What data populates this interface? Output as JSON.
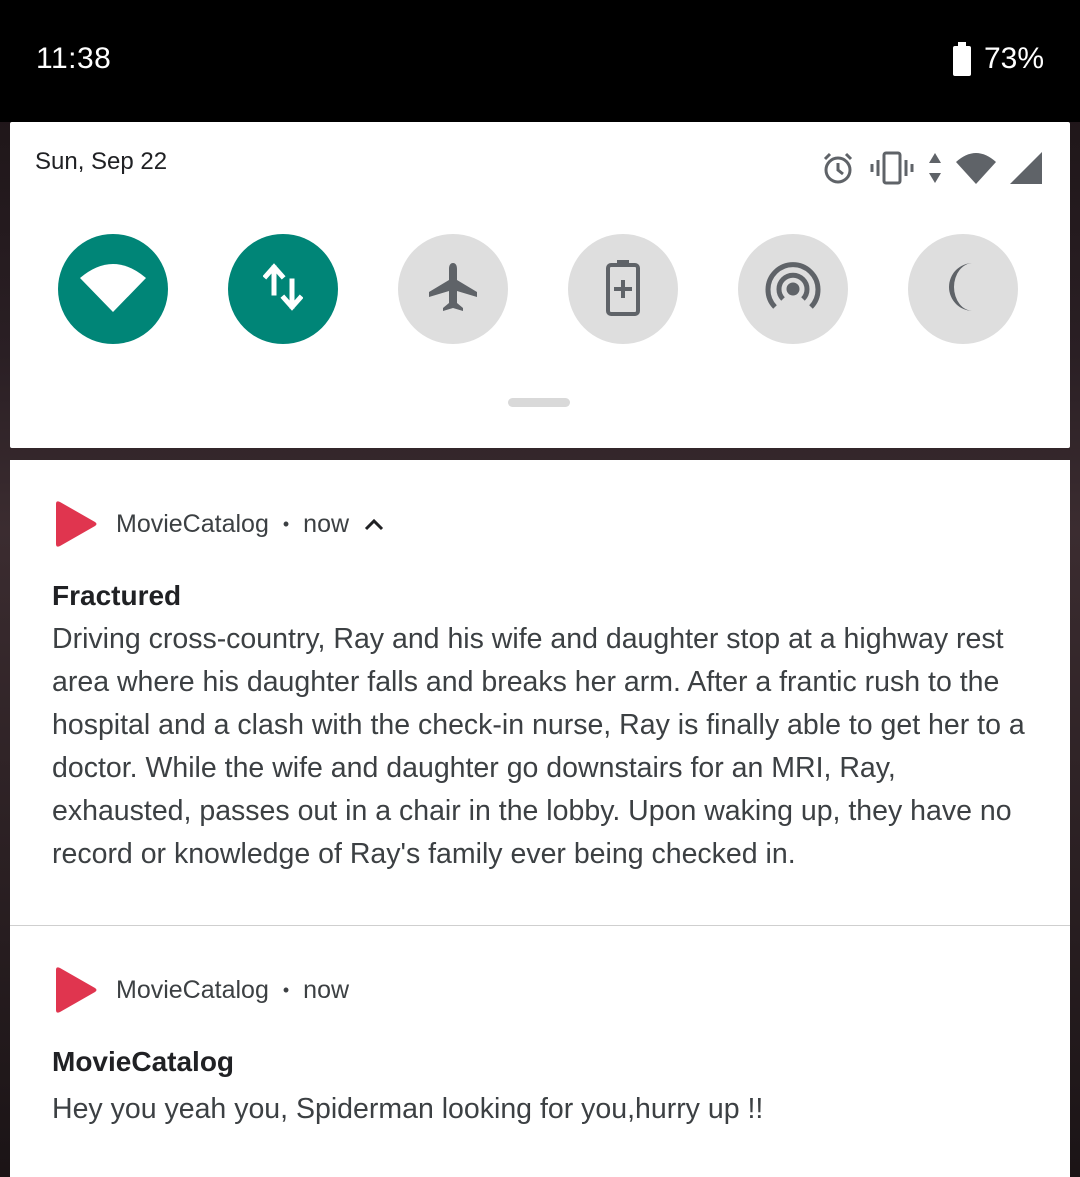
{
  "status_bar": {
    "time": "11:38",
    "battery_percent": "73%",
    "battery_icon": "battery-icon"
  },
  "quick_settings": {
    "date": "Sun, Sep 22",
    "status_icons": [
      "alarm-icon",
      "vibrate-icon",
      "data-activity-icon",
      "wifi-signal-icon",
      "cell-signal-icon"
    ],
    "tiles": [
      {
        "name": "wifi",
        "icon": "wifi-icon",
        "on": true
      },
      {
        "name": "mobile-data",
        "icon": "data-arrows-icon",
        "on": true
      },
      {
        "name": "airplane-mode",
        "icon": "airplane-icon",
        "on": false
      },
      {
        "name": "battery-saver",
        "icon": "battery-saver-icon",
        "on": false
      },
      {
        "name": "hotspot",
        "icon": "hotspot-icon",
        "on": false
      },
      {
        "name": "do-not-disturb",
        "icon": "moon-icon",
        "on": false
      }
    ],
    "colors": {
      "tile_on": "#008577",
      "tile_off": "#dedede",
      "icon_off": "#5f6368"
    }
  },
  "notifications": [
    {
      "app_name": "MovieCatalog",
      "time": "now",
      "expanded": true,
      "title": "Fractured",
      "body": "Driving cross-country, Ray and his wife and daughter stop at a highway rest area where his daughter falls and breaks her arm. After a frantic rush to the hospital and a clash with the check-in nurse, Ray is finally able to get her to a doctor. While the wife and daughter go downstairs for an MRI, Ray, exhausted, passes out in a chair in the lobby. Upon waking up, they have no record or knowledge of Ray's family ever being checked in."
    },
    {
      "app_name": "MovieCatalog",
      "time": "now",
      "expanded": false,
      "title": "MovieCatalog",
      "body": "Hey you yeah you, Spiderman looking for you,hurry up !!"
    }
  ],
  "app_icon_color": "#e0354f",
  "separator": "•"
}
